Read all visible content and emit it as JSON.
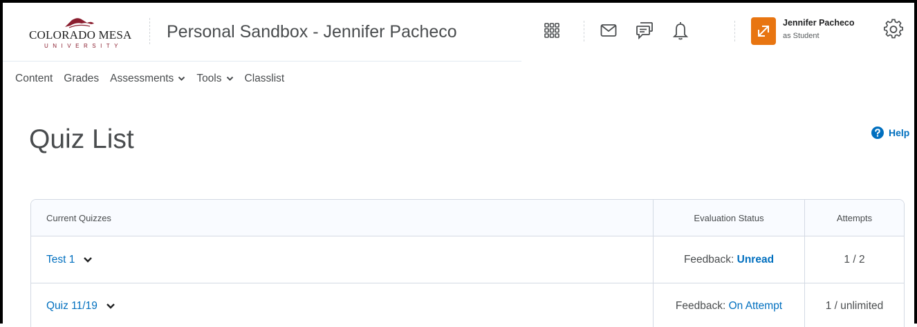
{
  "header": {
    "logo": {
      "wordmark": "COLORADO MESA",
      "subtext": "UNIVERSITY"
    },
    "course_title": "Personal Sandbox - Jennifer Pacheco",
    "icons": [
      "grid-icon",
      "mail-icon",
      "chat-icon",
      "bell-icon",
      "role-switch-icon",
      "gear-icon"
    ],
    "user": {
      "name": "Jennifer Pacheco",
      "role": "as Student"
    },
    "accent": "#e87511"
  },
  "nav": {
    "items": [
      {
        "label": "Content",
        "dropdown": false
      },
      {
        "label": "Grades",
        "dropdown": false
      },
      {
        "label": "Assessments",
        "dropdown": true
      },
      {
        "label": "Tools",
        "dropdown": true
      },
      {
        "label": "Classlist",
        "dropdown": false
      }
    ]
  },
  "page": {
    "title": "Quiz List",
    "help_label": "Help"
  },
  "table": {
    "columns": [
      "Current Quizzes",
      "Evaluation Status",
      "Attempts"
    ],
    "rows": [
      {
        "name": "Test 1",
        "feedback_label": "Feedback:",
        "feedback_value": "Unread",
        "attempts": "1 / 2"
      },
      {
        "name": "Quiz 11/19",
        "feedback_label": "Feedback:",
        "feedback_value": "On Attempt",
        "attempts": "1 / unlimited"
      }
    ]
  },
  "colors": {
    "link": "#006fbf",
    "text": "#494c4e",
    "border": "#d3d9e3"
  }
}
